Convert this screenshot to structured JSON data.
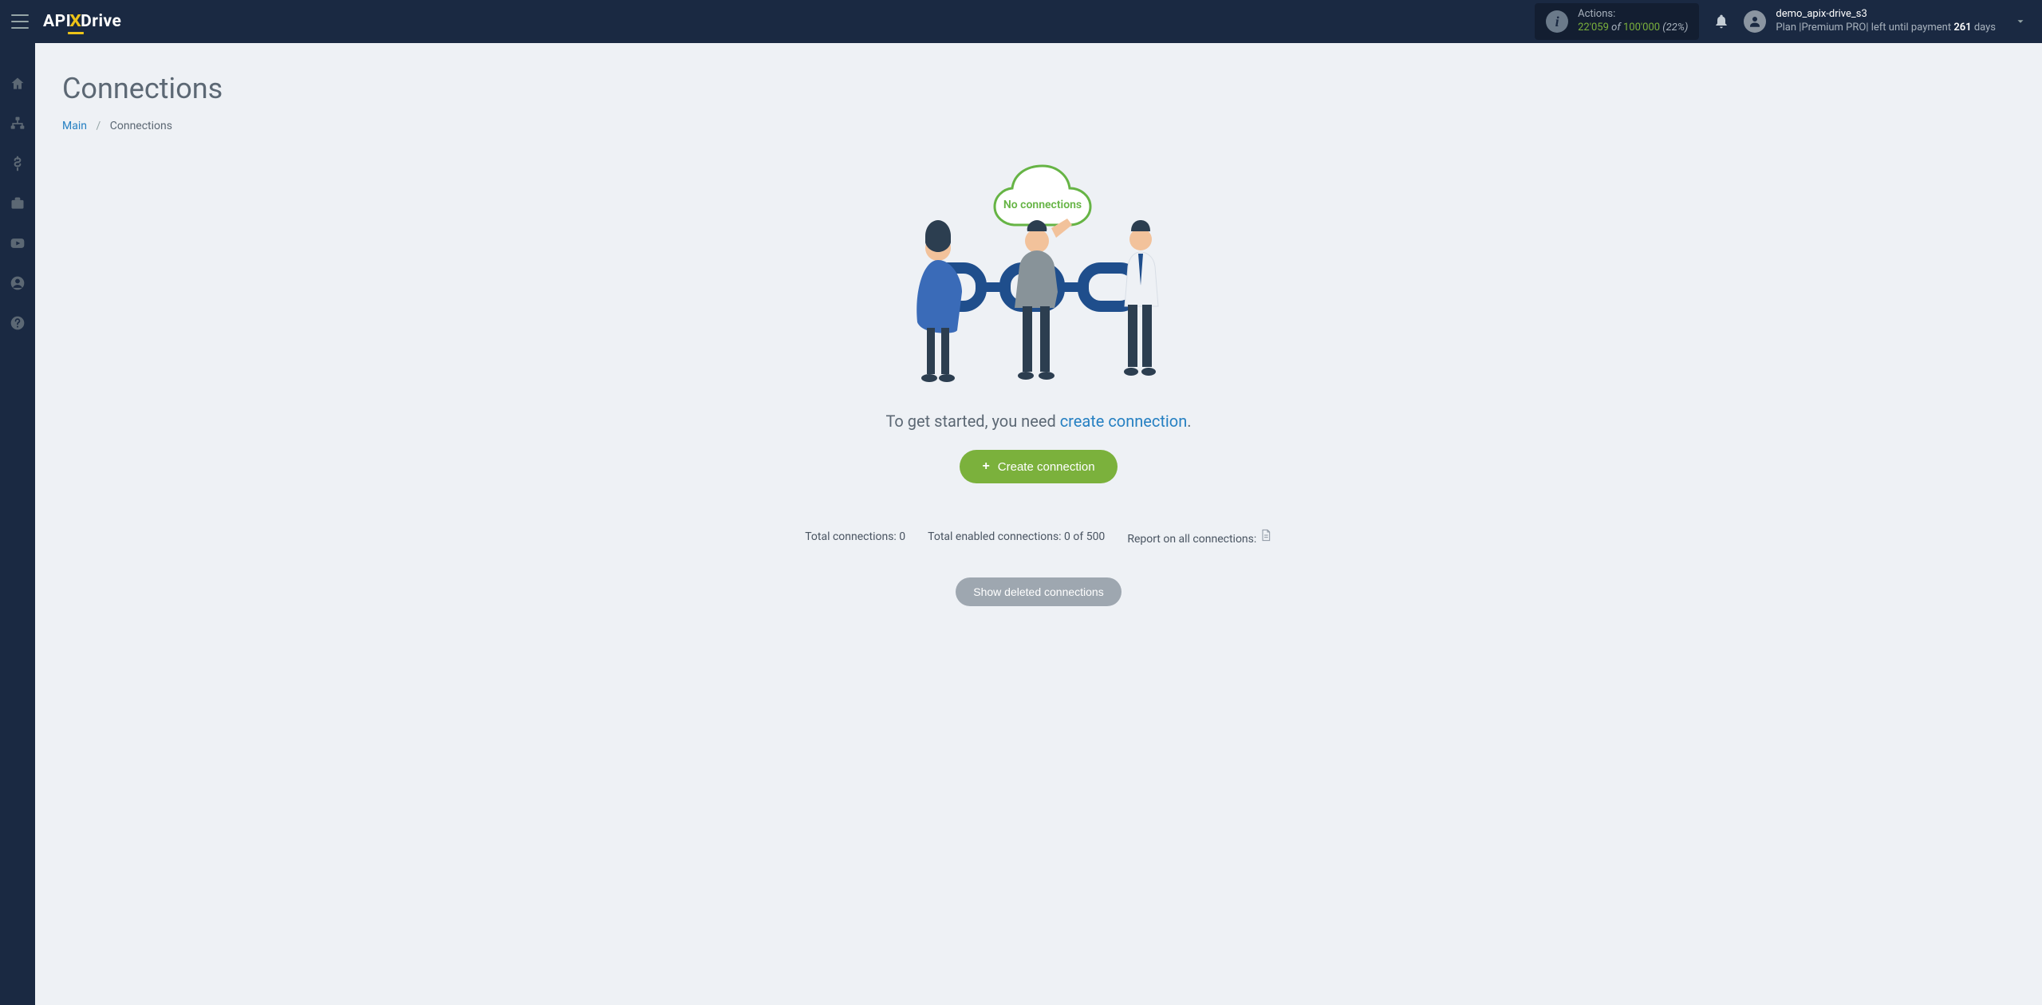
{
  "header": {
    "logo_a": "API",
    "logo_b": "Drive",
    "actions_label": "Actions:",
    "actions_used": "22'059",
    "actions_of": "of",
    "actions_total": "100'000",
    "actions_pct": "(22%)",
    "user_name": "demo_apix-drive_s3",
    "plan_prefix": "Plan |",
    "plan_name": "Premium PRO",
    "plan_mid": "| left until payment ",
    "plan_days": "261",
    "plan_suffix": " days"
  },
  "page": {
    "title": "Connections",
    "crumb_main": "Main",
    "crumb_sep": "/",
    "crumb_current": "Connections"
  },
  "empty": {
    "cloud_label": "No connections",
    "getstarted_a": "To get started, you need ",
    "getstarted_link": "create connection",
    "getstarted_b": ".",
    "create_btn": "Create connection"
  },
  "stats": {
    "total": "Total connections: 0",
    "enabled": "Total enabled connections: 0 of 500",
    "report": "Report on all connections:"
  },
  "deleted_btn": "Show deleted connections"
}
